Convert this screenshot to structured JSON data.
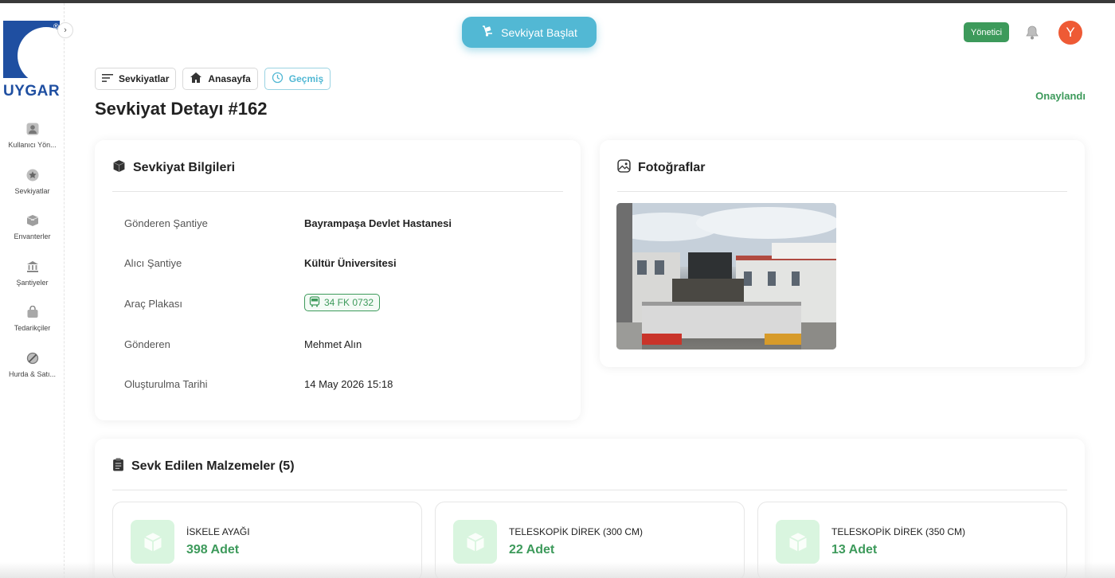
{
  "brand": {
    "name": "UYGAR",
    "registered_mark": "®",
    "color": "#1f4fa1"
  },
  "sidebar": {
    "collapse_icon": "chevron-right-icon",
    "items": [
      {
        "label": "Kullanıcı Yön...",
        "icon": "user-icon"
      },
      {
        "label": "Sevkiyatlar",
        "icon": "star-icon"
      },
      {
        "label": "Envanterler",
        "icon": "box-icon"
      },
      {
        "label": "Şantiyeler",
        "icon": "bank-icon"
      },
      {
        "label": "Tedarikçiler",
        "icon": "bag-icon"
      },
      {
        "label": "Hurda & Satı...",
        "icon": "slash-circle-icon"
      }
    ]
  },
  "header": {
    "start_button_label": "Sevkiyat Başlat",
    "role_badge": "Yönetici",
    "avatar_initial": "Y",
    "accent_color": "#52b8d4",
    "success_color": "#3d9a5b"
  },
  "breadcrumb": {
    "items": [
      {
        "label": "Sevkiyatlar",
        "icon": "list-icon"
      },
      {
        "label": "Anasayfa",
        "icon": "home-icon"
      },
      {
        "label": "Geçmiş",
        "icon": "history-icon",
        "active": true
      }
    ]
  },
  "page": {
    "title": "Sevkiyat Detayı #162",
    "status": "Onaylandı"
  },
  "info_card": {
    "title": "Sevkiyat Bilgileri",
    "rows": [
      {
        "key": "Gönderen Şantiye",
        "value": "Bayrampaşa Devlet Hastanesi"
      },
      {
        "key": "Alıcı Şantiye",
        "value": "Kültür Üniversitesi"
      },
      {
        "key": "Araç Plakası",
        "value": "34 FK 0732"
      },
      {
        "key": "Gönderen",
        "value": "Mehmet Alın"
      },
      {
        "key": "Oluşturulma Tarihi",
        "value": "14 May 2026 15:18"
      }
    ]
  },
  "photo_card": {
    "title": "Fotoğraflar"
  },
  "materials_card": {
    "title": "Sevk Edilen Malzemeler (5)",
    "items": [
      {
        "name": "İSKELE AYAĞI",
        "quantity": "398 Adet"
      },
      {
        "name": "TELESKOPİK DİREK (300 CM)",
        "quantity": "22 Adet"
      },
      {
        "name": "TELESKOPİK DİREK (350 CM)",
        "quantity": "13 Adet"
      }
    ]
  }
}
